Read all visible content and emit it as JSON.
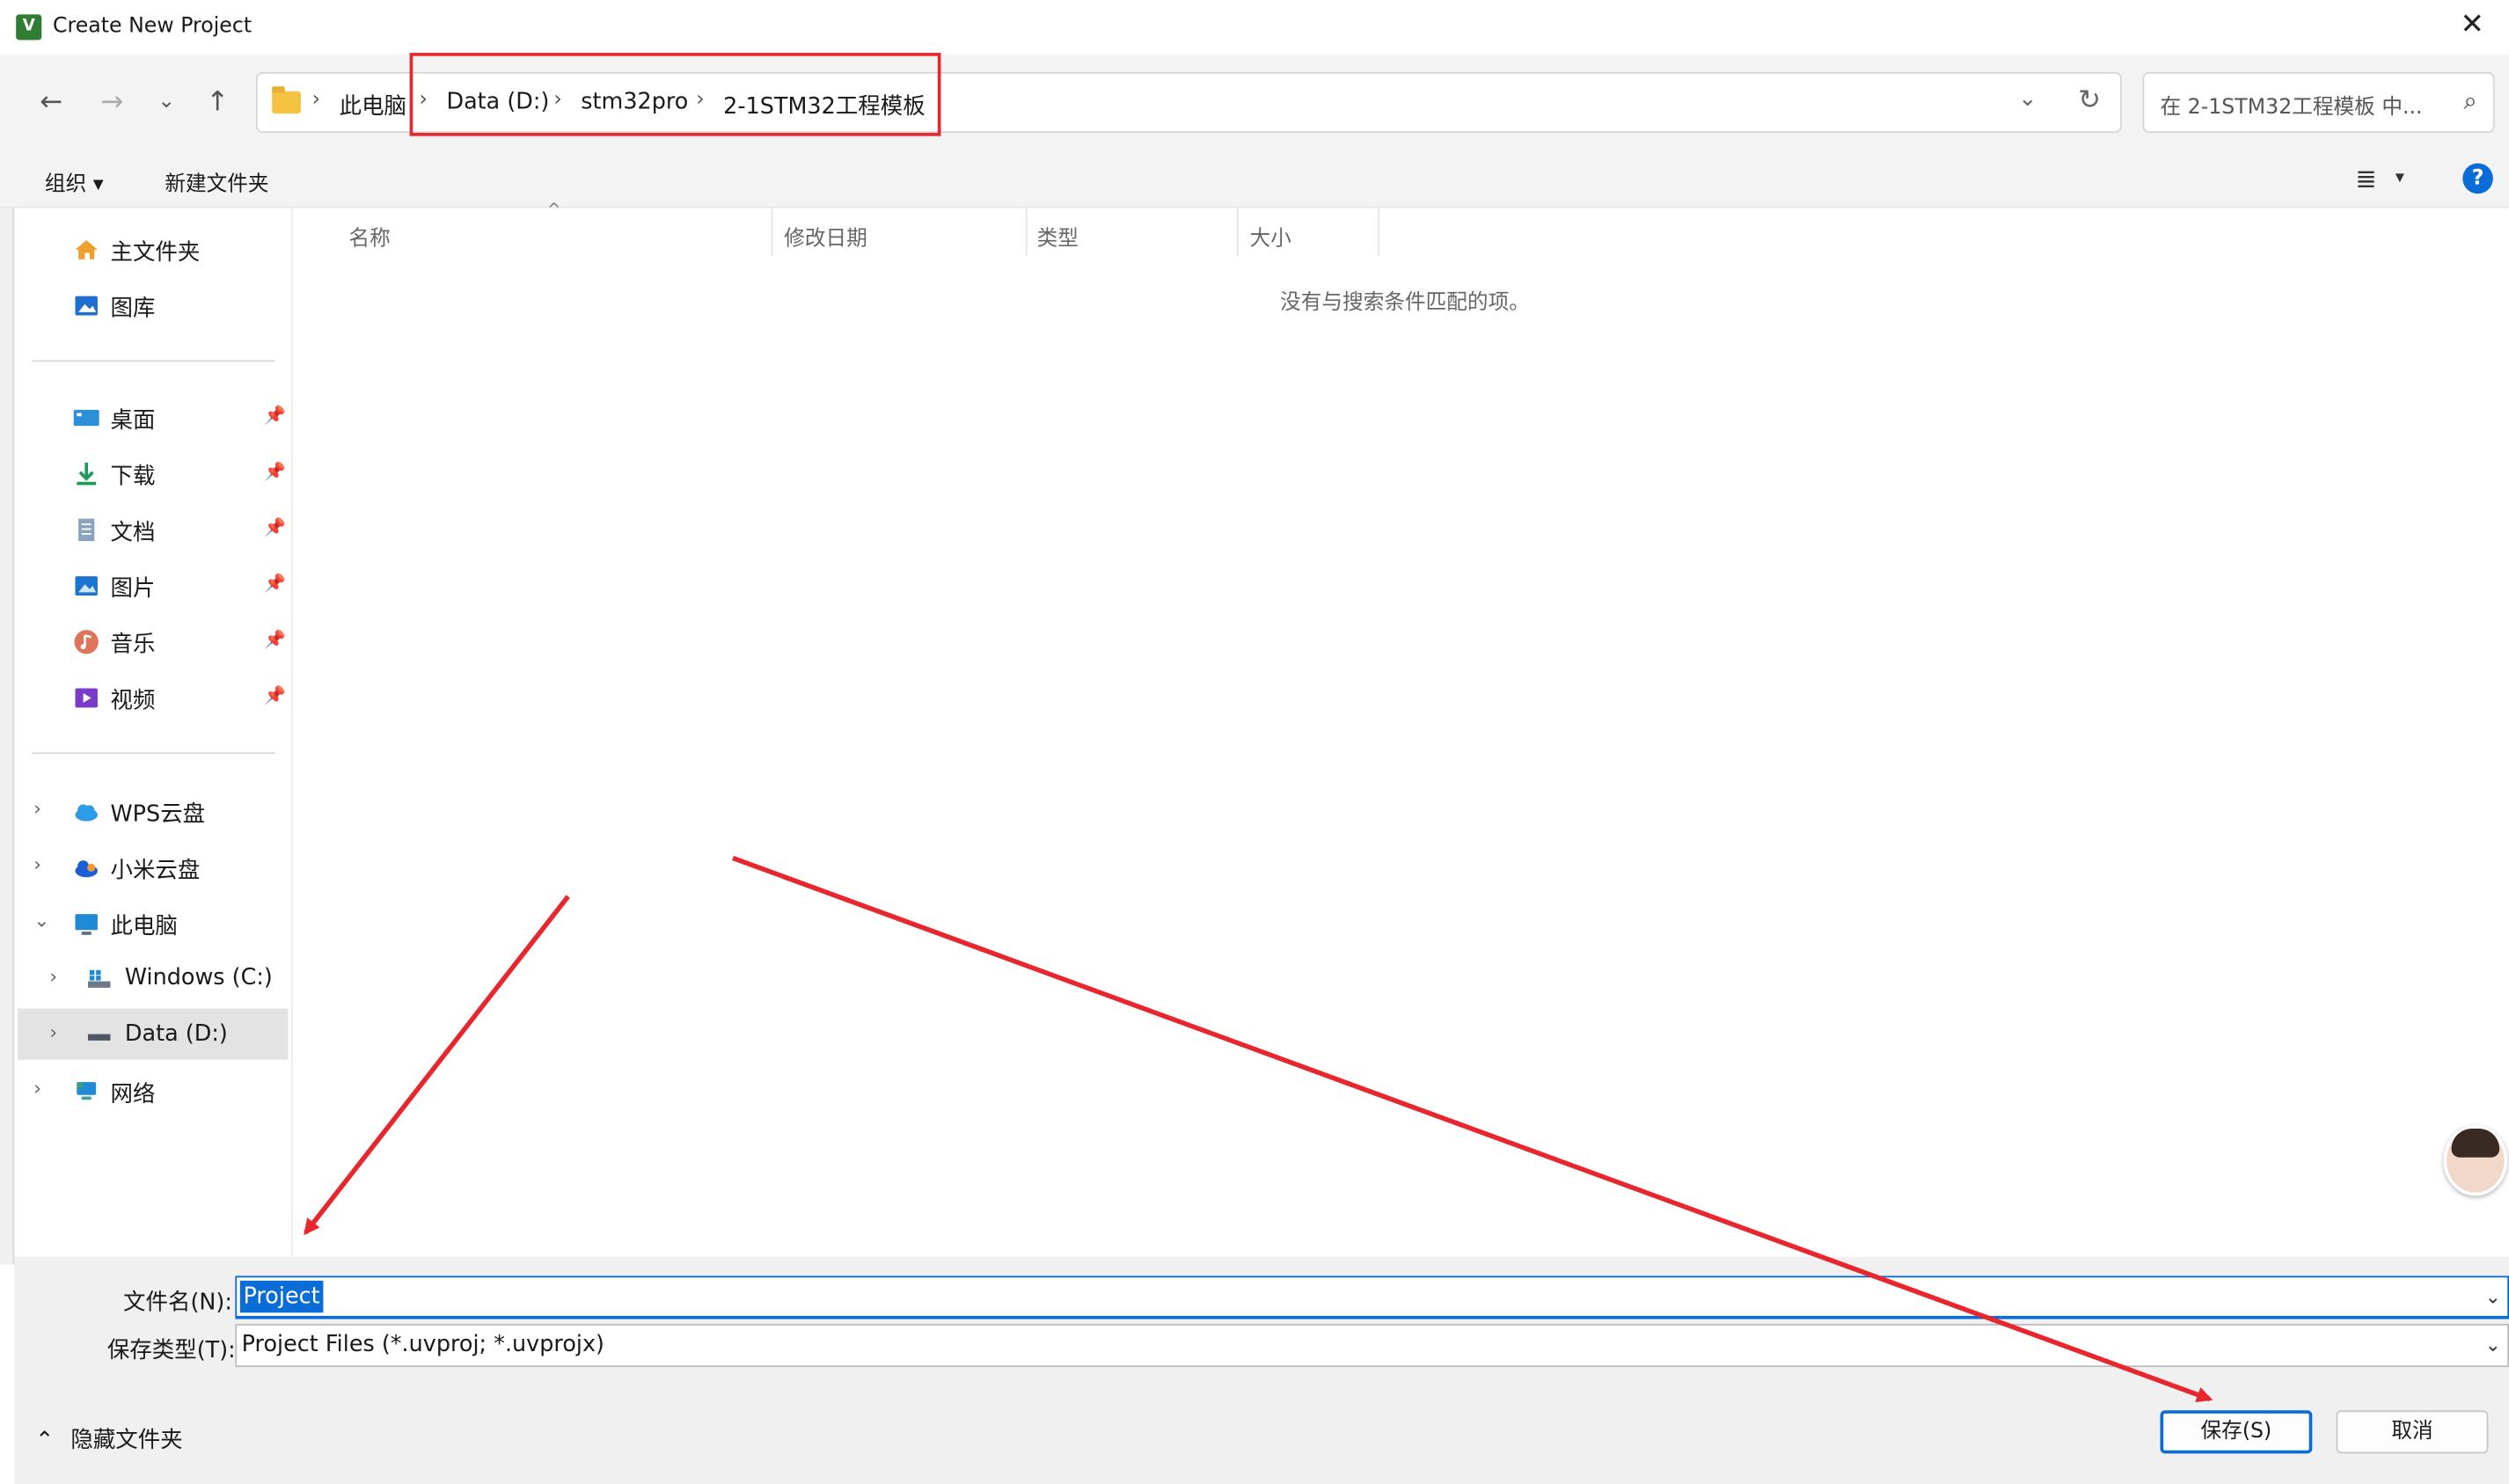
{
  "window": {
    "title": "Create New Project",
    "close_glyph": "✕"
  },
  "nav": {
    "back": "←",
    "forward": "→",
    "recent": "⌄",
    "up": "↑",
    "breadcrumbs": [
      "此电脑",
      "Data (D:)",
      "stm32pro",
      "2-1STM32工程模板"
    ],
    "separator": "›",
    "dropdown": "⌄",
    "refresh": "↻",
    "search_placeholder": "在 2-1STM32工程模板 中...",
    "search_icon": "⌕"
  },
  "toolbar": {
    "organize": "组织 ▾",
    "new_folder": "新建文件夹",
    "view_icon": "≣",
    "view_drop": "▾",
    "help": "?"
  },
  "sidebar": {
    "quick": [
      {
        "label": "主文件夹",
        "icon": "home-icon"
      },
      {
        "label": "图库",
        "icon": "gallery-icon"
      }
    ],
    "pinned": [
      {
        "label": "桌面",
        "icon": "desktop-icon"
      },
      {
        "label": "下载",
        "icon": "download-icon"
      },
      {
        "label": "文档",
        "icon": "document-icon"
      },
      {
        "label": "图片",
        "icon": "pictures-icon"
      },
      {
        "label": "音乐",
        "icon": "music-icon"
      },
      {
        "label": "视频",
        "icon": "video-icon"
      }
    ],
    "pin_glyph": "📌",
    "tree": [
      {
        "label": "WPS云盘",
        "icon": "cloud-icon",
        "chevron": "›"
      },
      {
        "label": "小米云盘",
        "icon": "cloud-icon",
        "chevron": "›"
      },
      {
        "label": "此电脑",
        "icon": "computer-icon",
        "chevron": "⌄"
      },
      {
        "label": "Windows (C:)",
        "icon": "drive-icon",
        "chevron": "›"
      },
      {
        "label": "Data (D:)",
        "icon": "drive-icon",
        "chevron": "›"
      },
      {
        "label": "网络",
        "icon": "network-icon",
        "chevron": "›"
      }
    ]
  },
  "content": {
    "columns": [
      "名称",
      "修改日期",
      "类型",
      "大小"
    ],
    "sort_indicator": "^",
    "empty_message": "没有与搜索条件匹配的项。"
  },
  "form": {
    "filename_label": "文件名(N):",
    "filename_value": "Project",
    "filetype_label": "保存类型(T):",
    "filetype_value": "Project Files (*.uvproj; *.uvprojx)",
    "drop_glyph": "⌄"
  },
  "footer": {
    "hide_folders": "隐藏文件夹",
    "save": "保存(S)",
    "cancel": "取消"
  },
  "colors": {
    "accent": "#0a6cd6",
    "annotation": "#e8262d"
  }
}
